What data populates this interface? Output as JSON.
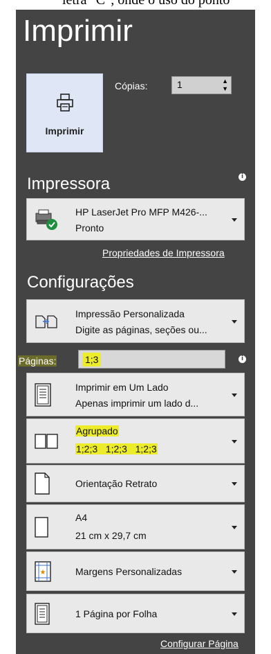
{
  "top_text": "letra \"C\", onde o uso do ponto",
  "panel": {
    "title": "Imprimir",
    "print_button_label": "Imprimir",
    "copies_label": "Cópias:",
    "copies_value": "1"
  },
  "printer": {
    "section_title": "Impressora",
    "name": "HP LaserJet Pro MFP M426-...",
    "status": "Pronto",
    "properties_link": "Propriedades de Impressora"
  },
  "settings": {
    "section_title": "Configurações",
    "print_range": {
      "title": "Impressão Personalizada",
      "subtitle": "Digite as páginas, seções ou..."
    },
    "pages_label": "Páginas:",
    "pages_value": "1;3",
    "sides": {
      "title": "Imprimir em Um Lado",
      "subtitle": "Apenas imprimir um lado d..."
    },
    "collate": {
      "title": "Agrupado",
      "subtitle": "1;2;3   1;2;3   1;2;3"
    },
    "orientation": {
      "title": "Orientação Retrato"
    },
    "paper_size": {
      "title": "A4",
      "subtitle": "21 cm x 29,7 cm"
    },
    "margins": {
      "title": "Margens Personalizadas"
    },
    "pages_per_sheet": {
      "title": "1 Página por Folha"
    },
    "page_setup_link": "Configurar Página"
  },
  "colors": {
    "panel_bg": "#444444",
    "highlight": "#ecec2a",
    "print_button_bg": "#dfe6f5"
  }
}
